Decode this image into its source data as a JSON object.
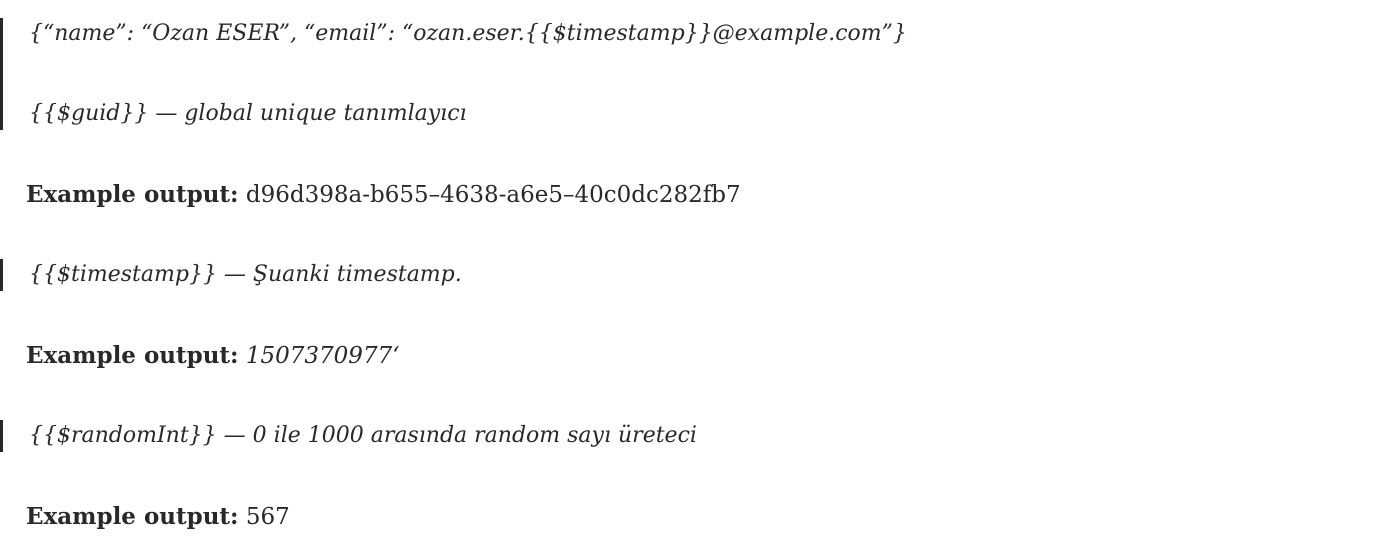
{
  "blocks": {
    "quote1": {
      "line1": "{“name”: “Ozan ESER”, “email”: “ozan.eser.{{$timestamp}}@example.com”}",
      "line2": "{{$guid}} — global unique tanımlayıcı"
    },
    "output1": {
      "label": "Example output:",
      "value": "d96d398a-b655–4638-a6e5–40c0dc282fb7"
    },
    "quote2": {
      "line1": "{{$timestamp}} — Şuanki timestamp."
    },
    "output2": {
      "label": "Example output:",
      "value": "1507370977‘"
    },
    "quote3": {
      "line1": "{{$randomInt}} — 0 ile 1000 arasında random sayı üreteci"
    },
    "output3": {
      "label": "Example output:",
      "value": "567"
    }
  },
  "colors": {
    "text": "#292929",
    "quote_bar": "#292929",
    "background": "#ffffff"
  }
}
